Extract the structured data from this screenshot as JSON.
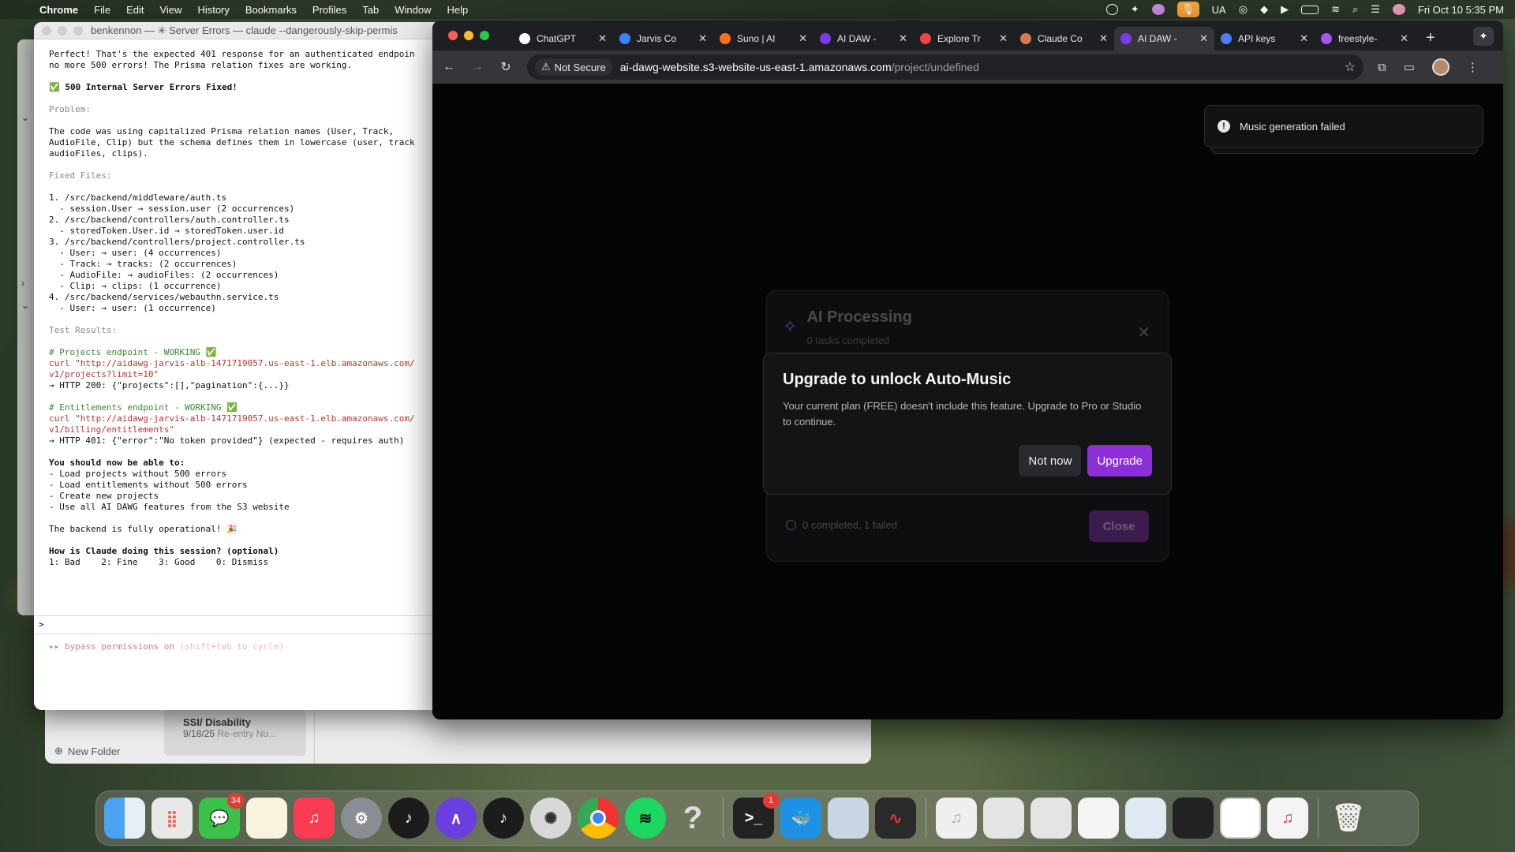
{
  "menubar": {
    "app": "Chrome",
    "menus": [
      "File",
      "Edit",
      "View",
      "History",
      "Bookmarks",
      "Profiles",
      "Tab",
      "Window",
      "Help"
    ],
    "input_indicator": "UA",
    "datetime": "Fri Oct 10  5:35 PM"
  },
  "terminal": {
    "title": "benkennon — ✳ Server Errors — claude --dangerously-skip-permis",
    "lines": [
      {
        "t": "Perfect! That's the expected 401 response for an authenticated endpoin",
        "c": ""
      },
      {
        "t": "no more 500 errors! The Prisma relation fixes are working.",
        "c": ""
      },
      {
        "t": "",
        "c": ""
      },
      {
        "t": "✅ 500 Internal Server Errors Fixed!",
        "c": "tb"
      },
      {
        "t": "",
        "c": ""
      },
      {
        "t": "Problem:",
        "c": "tgray"
      },
      {
        "t": "",
        "c": ""
      },
      {
        "t": "The code was using capitalized Prisma relation names (User, Track,",
        "c": ""
      },
      {
        "t": "AudioFile, Clip) but the schema defines them in lowercase (user, track",
        "c": ""
      },
      {
        "t": "audioFiles, clips).",
        "c": ""
      },
      {
        "t": "",
        "c": ""
      },
      {
        "t": "Fixed Files:",
        "c": "tgray"
      },
      {
        "t": "",
        "c": ""
      },
      {
        "t": "1. /src/backend/middleware/auth.ts",
        "c": ""
      },
      {
        "t": "  - session.User → session.user (2 occurrences)",
        "c": ""
      },
      {
        "t": "2. /src/backend/controllers/auth.controller.ts",
        "c": ""
      },
      {
        "t": "  - storedToken.User.id → storedToken.user.id",
        "c": ""
      },
      {
        "t": "3. /src/backend/controllers/project.controller.ts",
        "c": ""
      },
      {
        "t": "  - User: → user: (4 occurrences)",
        "c": ""
      },
      {
        "t": "  - Track: → tracks: (2 occurrences)",
        "c": ""
      },
      {
        "t": "  - AudioFile: → audioFiles: (2 occurrences)",
        "c": ""
      },
      {
        "t": "  - Clip: → clips: (1 occurrence)",
        "c": ""
      },
      {
        "t": "4. /src/backend/services/webauthn.service.ts",
        "c": ""
      },
      {
        "t": "  - User: → user: (1 occurrence)",
        "c": ""
      },
      {
        "t": "",
        "c": ""
      },
      {
        "t": "Test Results:",
        "c": "tgray"
      },
      {
        "t": "",
        "c": ""
      },
      {
        "t": "# Projects endpoint - WORKING ✅",
        "c": "tgreen"
      },
      {
        "t": "curl \"http://aidawg-jarvis-alb-1471719057.us-east-1.elb.amazonaws.com/",
        "c": "tred"
      },
      {
        "t": "v1/projects?limit=10\"",
        "c": "tred"
      },
      {
        "t": "→ HTTP 200: {\"projects\":[],\"pagination\":{...}}",
        "c": ""
      },
      {
        "t": "",
        "c": ""
      },
      {
        "t": "# Entitlements endpoint - WORKING ✅",
        "c": "tgreen"
      },
      {
        "t": "curl \"http://aidawg-jarvis-alb-1471719057.us-east-1.elb.amazonaws.com/",
        "c": "tred"
      },
      {
        "t": "v1/billing/entitlements\"",
        "c": "tred"
      },
      {
        "t": "→ HTTP 401: {\"error\":\"No token provided\"} (expected - requires auth)",
        "c": ""
      },
      {
        "t": "",
        "c": ""
      },
      {
        "t": "You should now be able to:",
        "c": "tb"
      },
      {
        "t": "- Load projects without 500 errors",
        "c": ""
      },
      {
        "t": "- Load entitlements without 500 errors",
        "c": ""
      },
      {
        "t": "- Create new projects",
        "c": ""
      },
      {
        "t": "- Use all AI DAWG features from the S3 website",
        "c": ""
      },
      {
        "t": "",
        "c": ""
      },
      {
        "t": "The backend is fully operational! 🎉",
        "c": ""
      },
      {
        "t": "",
        "c": ""
      },
      {
        "t": "How is Claude doing this session? (optional)",
        "c": "tb"
      },
      {
        "t": "1: Bad    2: Fine    3: Good    0: Dismiss",
        "c": ""
      }
    ],
    "prompt_symbol": ">",
    "footer_bold": "▸▸ bypass permissions on",
    "footer_hint": " (shift+tab to cycle)"
  },
  "finder": {
    "new_folder": "New Folder",
    "note_title": "SSI/ Disability",
    "note_date": "9/18/25",
    "note_preview": "Re-entry Nu..."
  },
  "chrome": {
    "tabs": [
      {
        "label": "ChatGPT",
        "fav": "#ffffff",
        "icon": "openai-icon"
      },
      {
        "label": "Jarvis Co",
        "fav": "#3b82f6",
        "icon": "jarvis-icon"
      },
      {
        "label": "Suno | AI",
        "fav": "#f97316",
        "icon": "suno-icon"
      },
      {
        "label": "AI DAW -",
        "fav": "#7c3aed",
        "icon": "ai-daw-icon"
      },
      {
        "label": "Explore Tr",
        "fav": "#ef4444",
        "icon": "explore-icon"
      },
      {
        "label": "Claude Co",
        "fav": "#d97757",
        "icon": "claude-icon"
      },
      {
        "label": "AI DAW -",
        "fav": "#7c3aed",
        "icon": "ai-daw-icon",
        "active": true
      },
      {
        "label": "API keys",
        "fav": "#4f7df5",
        "icon": "api-keys-icon"
      },
      {
        "label": "freestyle-",
        "fav": "#a855f7",
        "icon": "freestyle-icon"
      }
    ],
    "url_security": "Not Secure",
    "url_host": "ai-dawg-website.s3-website-us-east-1.amazonaws.com",
    "url_path": "/project/undefined"
  },
  "toast": {
    "message": "Music generation failed"
  },
  "ai_panel": {
    "title": "AI Processing",
    "subtitle": "0 tasks completed",
    "status": "0 completed, 1 failed",
    "close_label": "Close"
  },
  "modal": {
    "title": "Upgrade to unlock Auto-Music",
    "body": "Your current plan (FREE) doesn't include this feature. Upgrade to Pro or Studio to continue.",
    "not_now_label": "Not now",
    "upgrade_label": "Upgrade"
  },
  "dock": {
    "messages_badge": "34",
    "terminal_badge": "1"
  }
}
